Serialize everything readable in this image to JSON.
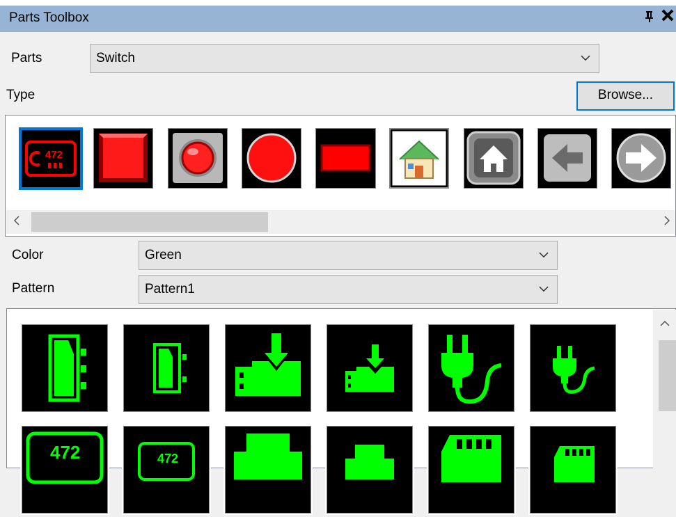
{
  "panel": {
    "title": "Parts Toolbox",
    "pin_glyph": "⊕",
    "close_glyph": "✕"
  },
  "parts": {
    "label": "Parts",
    "value": "Switch"
  },
  "type": {
    "label": "Type",
    "browse_label": "Browse..."
  },
  "type_items": [
    {
      "name": "counter-switch-icon"
    },
    {
      "name": "red-square-button-icon"
    },
    {
      "name": "red-round-button-gray-frame-icon"
    },
    {
      "name": "red-circle-button-icon"
    },
    {
      "name": "red-rect-button-icon"
    },
    {
      "name": "home-color-icon"
    },
    {
      "name": "home-gray-icon"
    },
    {
      "name": "arrow-left-gray-icon"
    },
    {
      "name": "arrow-right-gray-icon"
    }
  ],
  "color": {
    "label": "Color",
    "value": "Green"
  },
  "pattern": {
    "label": "Pattern",
    "value": "Pattern1"
  },
  "counter_text": "472",
  "colors": {
    "accent": "#0078d7",
    "title_bar": "#98b4d4",
    "green": "#00ff00",
    "red": "#ff0000"
  }
}
